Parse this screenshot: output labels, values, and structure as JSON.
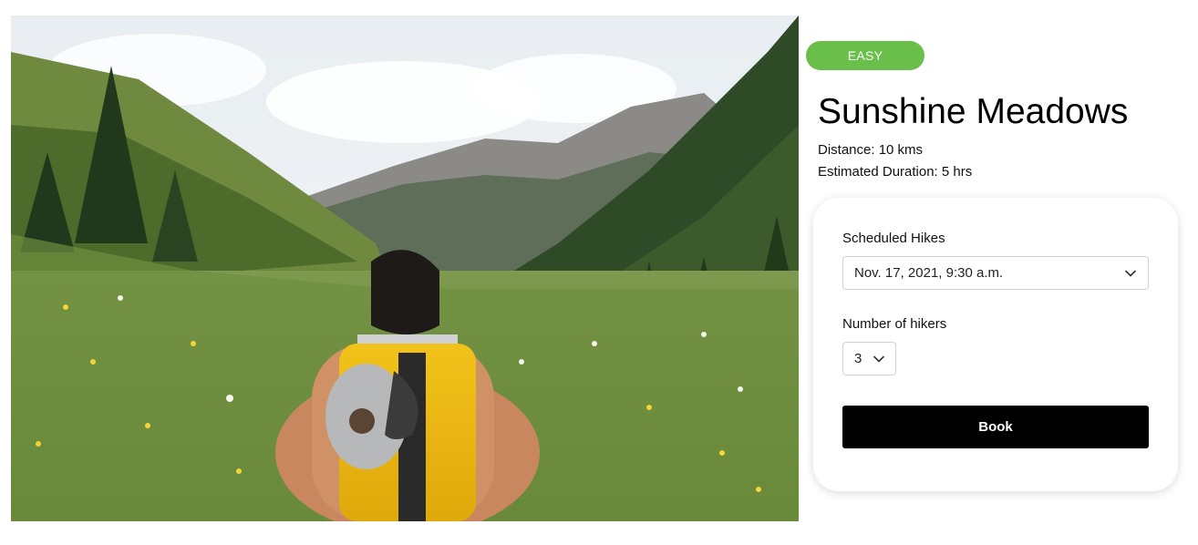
{
  "hike": {
    "difficulty": "EASY",
    "difficulty_color": "#6abf4b",
    "name": "Sunshine Meadows",
    "distance_text": "Distance: 10 kms",
    "duration_text": "Estimated Duration: 5 hrs"
  },
  "booking": {
    "scheduled_label": "Scheduled Hikes",
    "scheduled_value": "Nov. 17, 2021, 9:30 a.m.",
    "hikers_label": "Number of hikers",
    "hikers_value": "3",
    "book_label": "Book"
  },
  "icons": {
    "dropdown": "chevron-down-icon"
  }
}
